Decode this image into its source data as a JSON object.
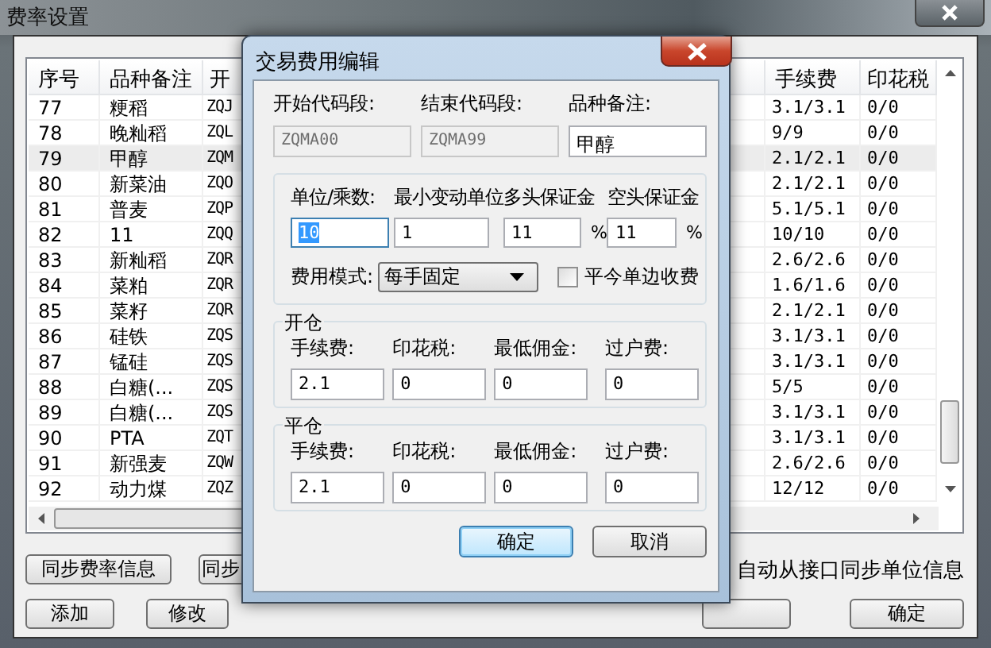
{
  "main_window": {
    "title": "费率设置",
    "table": {
      "columns": [
        "序号",
        "品种备注",
        "开",
        "手续费",
        "印花税"
      ],
      "rows": [
        {
          "cells": [
            "77",
            "粳稻",
            "ZQJ",
            "3.1/3.1",
            "0/0"
          ],
          "selected": false
        },
        {
          "cells": [
            "78",
            "晚籼稻",
            "ZQL",
            "9/9",
            "0/0"
          ],
          "selected": false
        },
        {
          "cells": [
            "79",
            "甲醇",
            "ZQM",
            "2.1/2.1",
            "0/0"
          ],
          "selected": true
        },
        {
          "cells": [
            "80",
            "新菜油",
            "ZQO",
            "2.1/2.1",
            "0/0"
          ],
          "selected": false
        },
        {
          "cells": [
            "81",
            "普麦",
            "ZQP",
            "5.1/5.1",
            "0/0"
          ],
          "selected": false
        },
        {
          "cells": [
            "82",
            "11",
            "ZQQ",
            "10/10",
            "0/0"
          ],
          "selected": false
        },
        {
          "cells": [
            "83",
            "新籼稻",
            "ZQR",
            "2.6/2.6",
            "0/0"
          ],
          "selected": false
        },
        {
          "cells": [
            "84",
            "菜粕",
            "ZQR",
            "1.6/1.6",
            "0/0"
          ],
          "selected": false
        },
        {
          "cells": [
            "85",
            "菜籽",
            "ZQR",
            "2.1/2.1",
            "0/0"
          ],
          "selected": false
        },
        {
          "cells": [
            "86",
            "硅铁",
            "ZQS",
            "3.1/3.1",
            "0/0"
          ],
          "selected": false
        },
        {
          "cells": [
            "87",
            "锰硅",
            "ZQS",
            "3.1/3.1",
            "0/0"
          ],
          "selected": false
        },
        {
          "cells": [
            "88",
            "白糖(...",
            "ZQS",
            "5/5",
            "0/0"
          ],
          "selected": false
        },
        {
          "cells": [
            "89",
            "白糖(...",
            "ZQS",
            "3.1/3.1",
            "0/0"
          ],
          "selected": false
        },
        {
          "cells": [
            "90",
            "PTA",
            "ZQT",
            "3.1/3.1",
            "0/0"
          ],
          "selected": false
        },
        {
          "cells": [
            "91",
            "新强麦",
            "ZQW",
            "2.6/2.6",
            "0/0"
          ],
          "selected": false
        },
        {
          "cells": [
            "92",
            "动力煤",
            "ZQZ",
            "12/12",
            "0/0"
          ],
          "selected": false
        }
      ]
    },
    "sync_buttons": [
      "同步费率信息",
      "同步"
    ],
    "auto_sync_label": "自动从接口同步单位信息",
    "buttons": [
      {
        "kind": "button",
        "label": "添加"
      },
      {
        "kind": "button",
        "label": "修改"
      },
      {
        "kind": "covered"
      },
      {
        "kind": "button",
        "label": "确定"
      }
    ]
  },
  "dialog": {
    "title": "交易费用编辑",
    "code_fields": [
      {
        "label": "开始代码段:",
        "value": "ZQMA00",
        "disabled": true
      },
      {
        "label": "结束代码段:",
        "value": "ZQMA99",
        "disabled": true
      },
      {
        "label": "品种备注:",
        "value": "甲醇",
        "disabled": false
      }
    ],
    "unit_fields": [
      {
        "label": "单位/乘数:",
        "value": "10",
        "text_selected": true
      },
      {
        "label": "最小变动单位",
        "value": "1",
        "text_selected": false
      },
      {
        "label": "多头保证金",
        "value": "11",
        "text_selected": false,
        "suffix": "%"
      },
      {
        "label": "空头保证金",
        "value": "11",
        "text_selected": false,
        "suffix": "%"
      }
    ],
    "fee_mode": {
      "label": "费用模式:",
      "value": "每手固定"
    },
    "close_today_single": {
      "label": "平今单边收费",
      "checked": false
    },
    "groups": [
      {
        "title": "开仓",
        "fields": [
          {
            "label": "手续费:",
            "value": "2.1"
          },
          {
            "label": "印花税:",
            "value": "0"
          },
          {
            "label": "最低佣金:",
            "value": "0"
          },
          {
            "label": "过户费:",
            "value": "0"
          }
        ]
      },
      {
        "title": "平仓",
        "fields": [
          {
            "label": "手续费:",
            "value": "2.1"
          },
          {
            "label": "印花税:",
            "value": "0"
          },
          {
            "label": "最低佣金:",
            "value": "0"
          },
          {
            "label": "过户费:",
            "value": "0"
          }
        ]
      }
    ],
    "buttons": [
      {
        "label": "确定",
        "default": true
      },
      {
        "label": "取消",
        "default": false
      }
    ]
  }
}
